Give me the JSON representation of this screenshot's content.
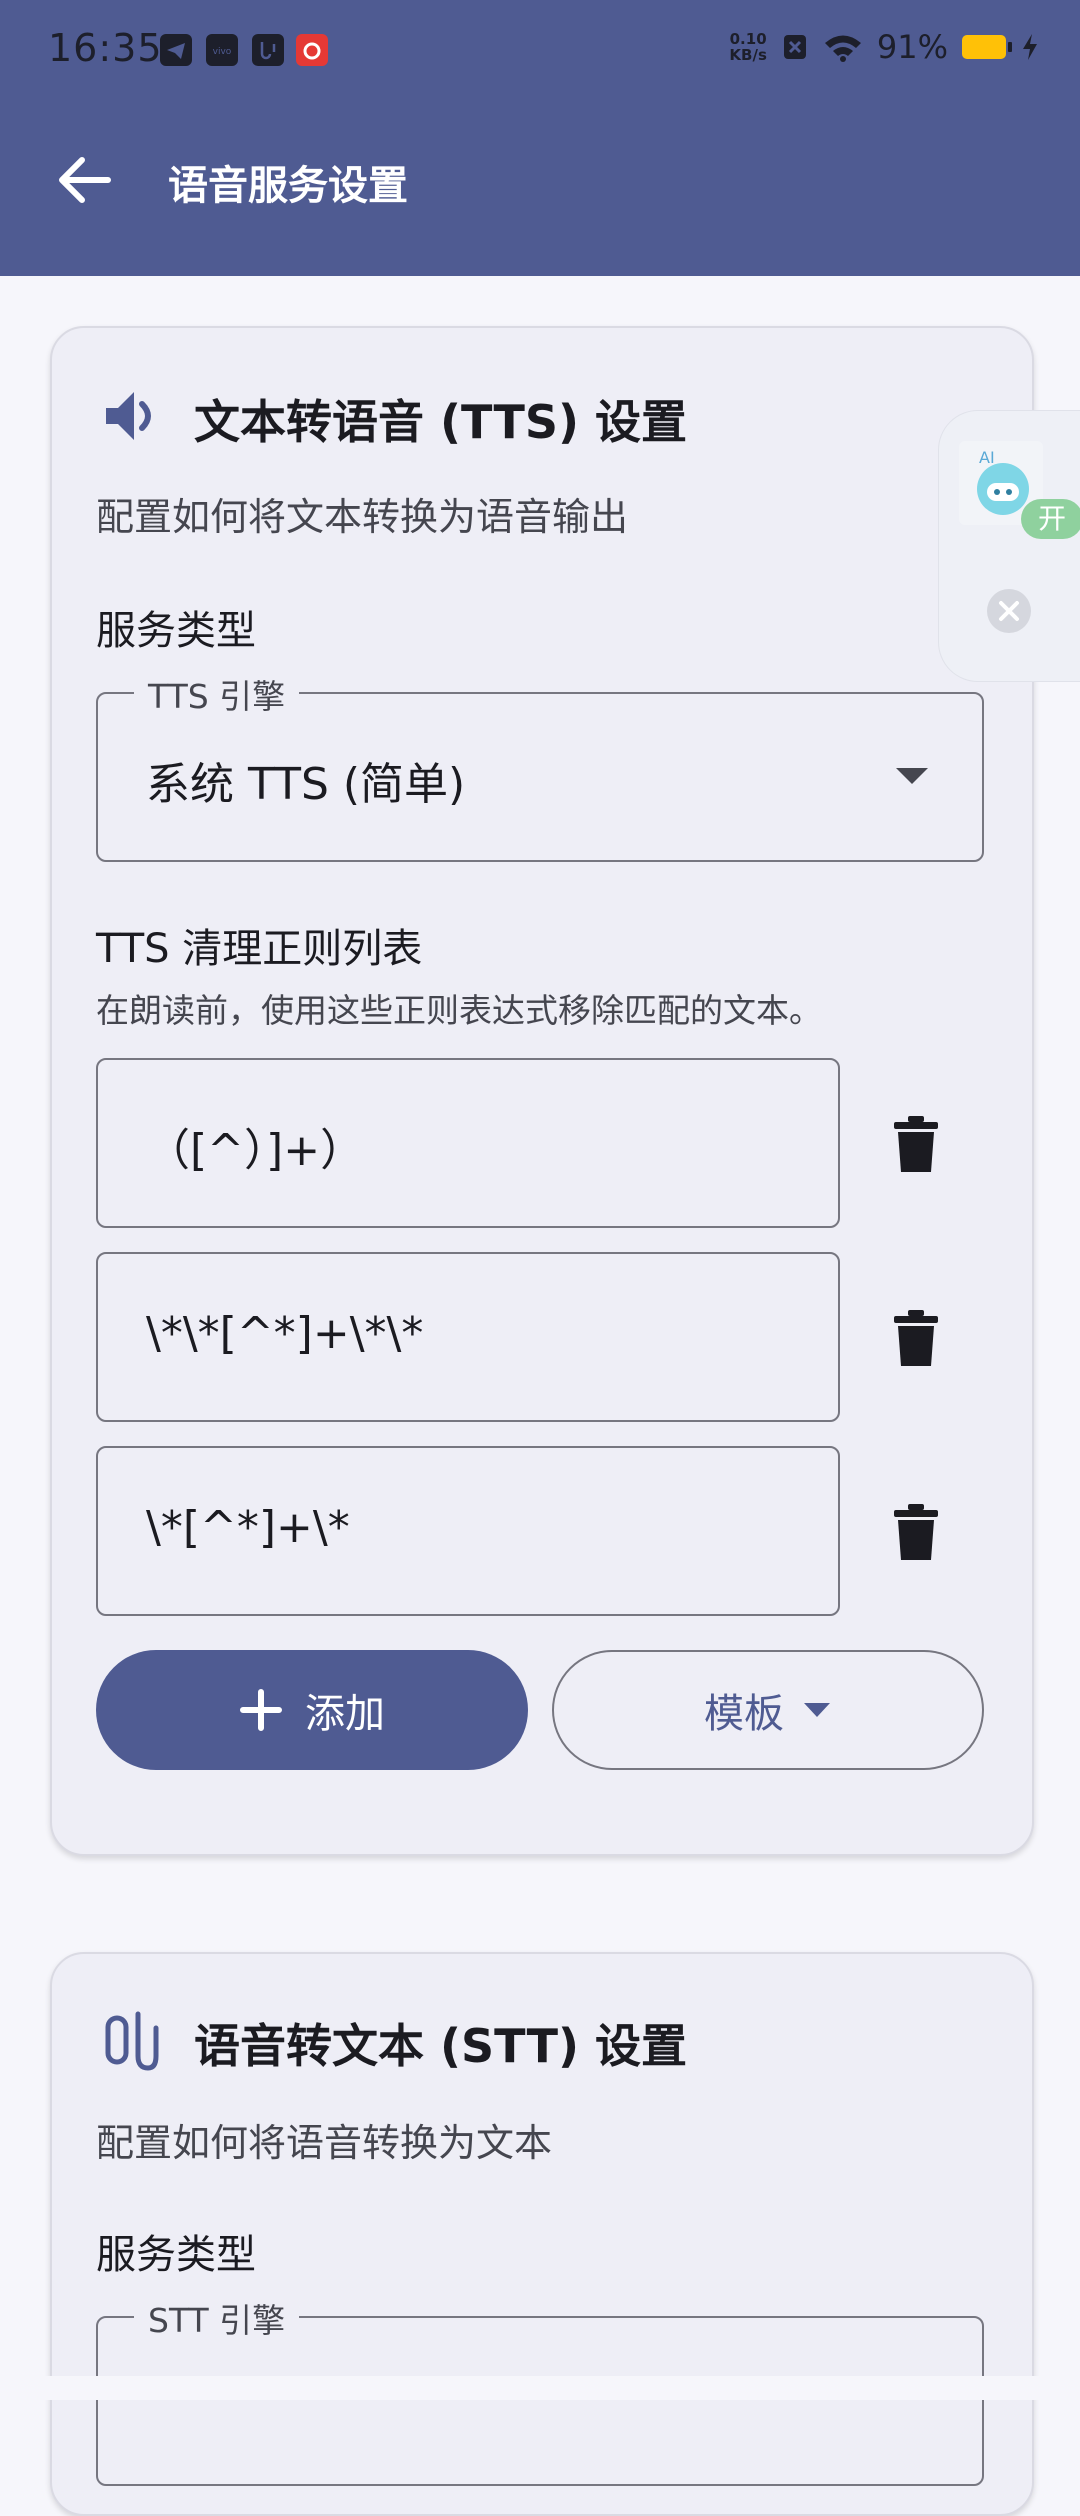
{
  "status_bar": {
    "time": "16:35",
    "net_speed_value": "0.10",
    "net_speed_unit": "KB/s",
    "battery": "91%"
  },
  "app_bar": {
    "title": "语音服务设置",
    "back_icon": "arrow-back-icon"
  },
  "tts_card": {
    "icon": "volume-icon",
    "title": "文本转语音 (TTS) 设置",
    "description": "配置如何将文本转换为语音输出",
    "service_type_label": "服务类型",
    "engine_field_label": "TTS 引擎",
    "engine_value": "系统 TTS (简单)",
    "regex_title": "TTS 清理正则列表",
    "regex_desc": "在朗读前，使用这些正则表达式移除匹配的文本。",
    "regex_items": [
      "（[^）]+）",
      "\\*\\*[^*]+\\*\\*",
      "\\*[^*]+\\*"
    ],
    "add_button": "添加",
    "template_button": "模板"
  },
  "stt_card": {
    "icon": "microphone-icon",
    "title": "语音转文本 (STT) 设置",
    "description": "配置如何将语音转换为文本",
    "service_type_label": "服务类型",
    "engine_field_label": "STT 引擎"
  },
  "floating_widget": {
    "badge": "开",
    "ai_label": "AI"
  },
  "colors": {
    "primary": "#4f5b92",
    "card_bg": "#eeeef6",
    "page_bg": "#f6f6fb",
    "battery": "#ffc107",
    "badge_green": "#8fd19e"
  }
}
